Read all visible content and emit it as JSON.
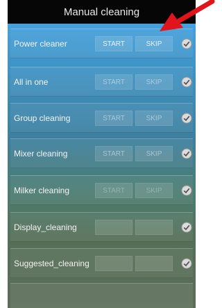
{
  "header": {
    "title": "Manual cleaning"
  },
  "rows": [
    {
      "label": "Power cleaner",
      "start": "START",
      "skip": "SKIP"
    },
    {
      "label": "All in one",
      "start": "START",
      "skip": "SKIP"
    },
    {
      "label": "Group cleaning",
      "start": "START",
      "skip": "SKIP"
    },
    {
      "label": "Mixer cleaning",
      "start": "START",
      "skip": "SKIP"
    },
    {
      "label": "Milker cleaning",
      "start": "START",
      "skip": "SKIP"
    },
    {
      "label": "Display_cleaning",
      "start": "",
      "skip": ""
    },
    {
      "label": "Suggested_cleaning",
      "start": "",
      "skip": ""
    }
  ],
  "icons": {
    "check": "check-circle-icon",
    "annotation": "red-arrow"
  },
  "colors": {
    "titlebar": "#060606",
    "arrow": "#e0141a",
    "text": "#f3f3f3"
  }
}
